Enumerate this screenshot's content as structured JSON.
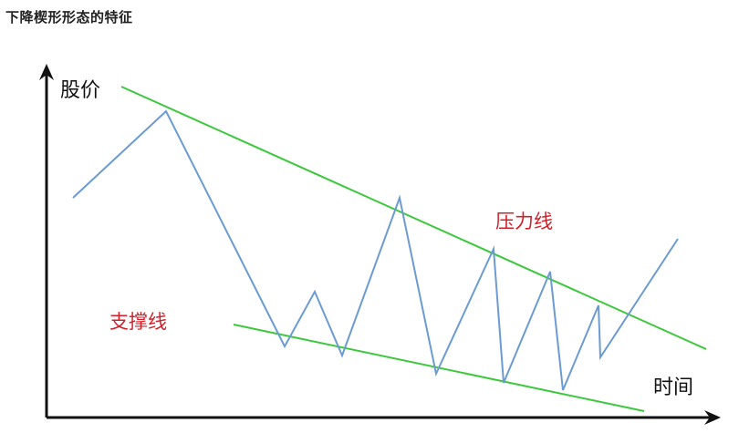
{
  "title": "下降楔形形态的特征",
  "y_axis_label": "股价",
  "x_axis_label": "时间",
  "resistance_label": "压力线",
  "support_label": "支撑线",
  "colors": {
    "trend_lines": "#3cc83c",
    "price_line": "#6b9bd2",
    "axes": "#111111",
    "labels": "#d0202a"
  }
}
